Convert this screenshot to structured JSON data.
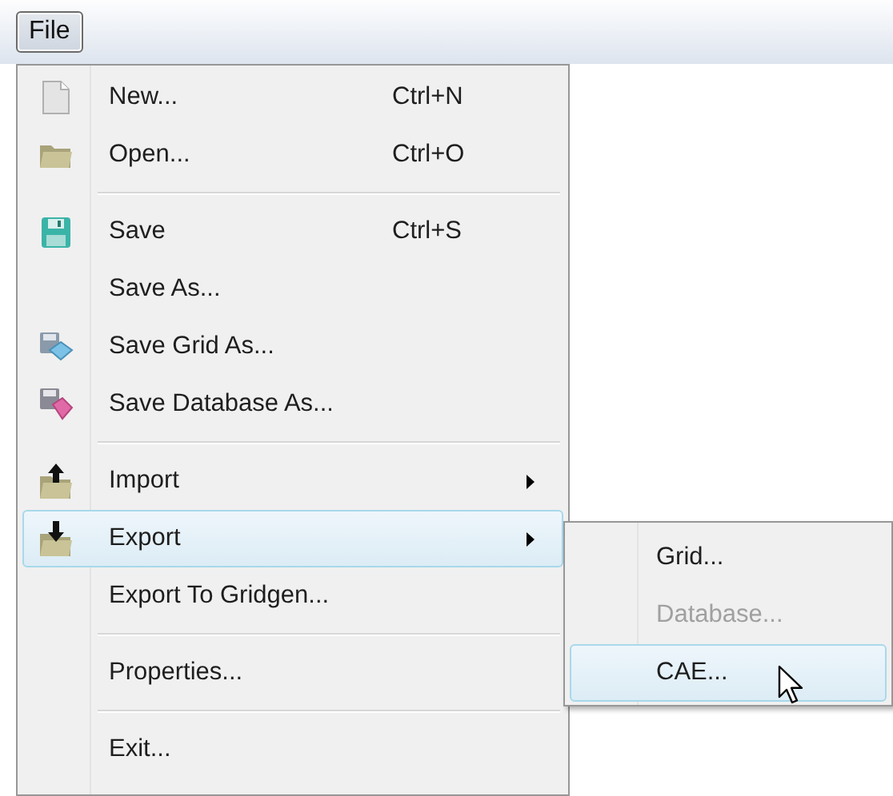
{
  "menu_bar": {
    "menus": [
      {
        "label": "File",
        "selected": true
      }
    ]
  },
  "file_menu": {
    "items": [
      {
        "kind": "item",
        "label": "New...",
        "shortcut": "Ctrl+N"
      },
      {
        "kind": "item",
        "label": "Open...",
        "shortcut": "Ctrl+O"
      },
      {
        "kind": "separator"
      },
      {
        "kind": "item",
        "label": "Save",
        "shortcut": "Ctrl+S"
      },
      {
        "kind": "item",
        "label": "Save As..."
      },
      {
        "kind": "item",
        "label": "Save Grid As..."
      },
      {
        "kind": "item",
        "label": "Save Database As..."
      },
      {
        "kind": "separator"
      },
      {
        "kind": "item",
        "label": "Import",
        "submenu": true,
        "selected": false
      },
      {
        "kind": "item",
        "label": "Export",
        "submenu": true,
        "selected": true
      },
      {
        "kind": "item",
        "label": "Export To Gridgen..."
      },
      {
        "kind": "separator"
      },
      {
        "kind": "item",
        "label": "Properties..."
      },
      {
        "kind": "separator"
      },
      {
        "kind": "item",
        "label": "Exit..."
      }
    ]
  },
  "export_submenu": {
    "items": [
      {
        "label": "Grid...",
        "disabled": false,
        "selected": false
      },
      {
        "label": "Database...",
        "disabled": true,
        "selected": false
      },
      {
        "label": "CAE...",
        "disabled": false,
        "selected": true
      }
    ]
  }
}
